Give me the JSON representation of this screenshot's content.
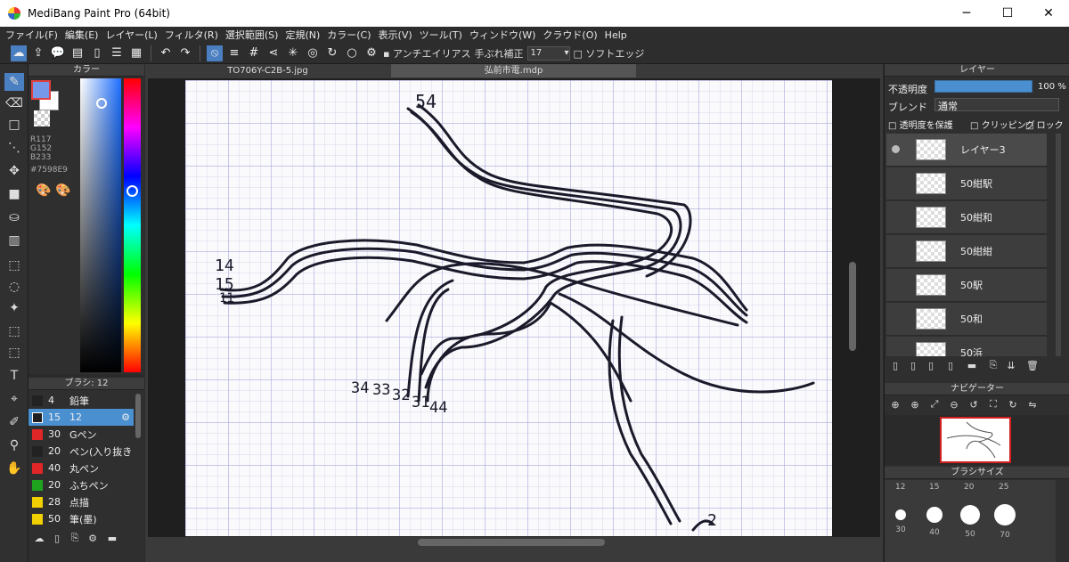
{
  "window": {
    "title": "MediBang Paint Pro (64bit)",
    "minimize": "─",
    "maximize": "☐",
    "close": "✕"
  },
  "menu": [
    "ファイル(F)",
    "編集(E)",
    "レイヤー(L)",
    "フィルタ(R)",
    "選択範囲(S)",
    "定規(N)",
    "カラー(C)",
    "表示(V)",
    "ツール(T)",
    "ウィンドウ(W)",
    "クラウド(O)",
    "Help"
  ],
  "toolbar": {
    "antialias": "アンチエイリアス",
    "stabilizer_label": "手ぶれ補正",
    "stabilizer_value": "17",
    "soft_edge": "ソフトエッジ"
  },
  "color_panel": {
    "title": "カラー",
    "r": "R117",
    "g": "G152",
    "b": "B233",
    "hex": "#7598E9",
    "fg": "#7598E9",
    "bg": "#ffffff"
  },
  "brush_panel": {
    "title": "ブラシ: 12",
    "items": [
      {
        "size": "4",
        "name": "鉛筆",
        "color": "#222222"
      },
      {
        "size": "15",
        "name": "12",
        "color": "#1f1f1f"
      },
      {
        "size": "30",
        "name": "Gペン",
        "color": "#e02626"
      },
      {
        "size": "20",
        "name": "ペン(入り抜き",
        "color": "#222222"
      },
      {
        "size": "40",
        "name": "丸ペン",
        "color": "#e02626"
      },
      {
        "size": "20",
        "name": "ふちペン",
        "color": "#1fa31f"
      },
      {
        "size": "28",
        "name": "点描",
        "color": "#f0d000"
      },
      {
        "size": "50",
        "name": "筆(墨)",
        "color": "#f0d000"
      }
    ]
  },
  "tabs": [
    "TO706Y-C2B-5.jpg",
    "弘前市電.mdp"
  ],
  "layers": {
    "title": "レイヤー",
    "opacity_label": "不透明度",
    "opacity_value": "100 %",
    "opacity": 1.0,
    "blend_label": "ブレンド",
    "blend_value": "通常",
    "protect": "透明度を保護",
    "clipping": "クリッピング",
    "lock": "ロック",
    "items": [
      "レイヤー3",
      "50紺駅",
      "50紺和",
      "50紺紺",
      "50駅",
      "50和",
      "50浜"
    ]
  },
  "navigator": {
    "title": "ナビゲーター"
  },
  "brush_size": {
    "title": "ブラシサイズ",
    "row1": [
      "12",
      "15",
      "20",
      "25"
    ],
    "row2": [
      "30",
      "40",
      "50",
      "70"
    ]
  },
  "canvas_labels": [
    "54",
    "14",
    "15",
    "11",
    "34",
    "33",
    "32",
    "31",
    "44",
    "2"
  ]
}
